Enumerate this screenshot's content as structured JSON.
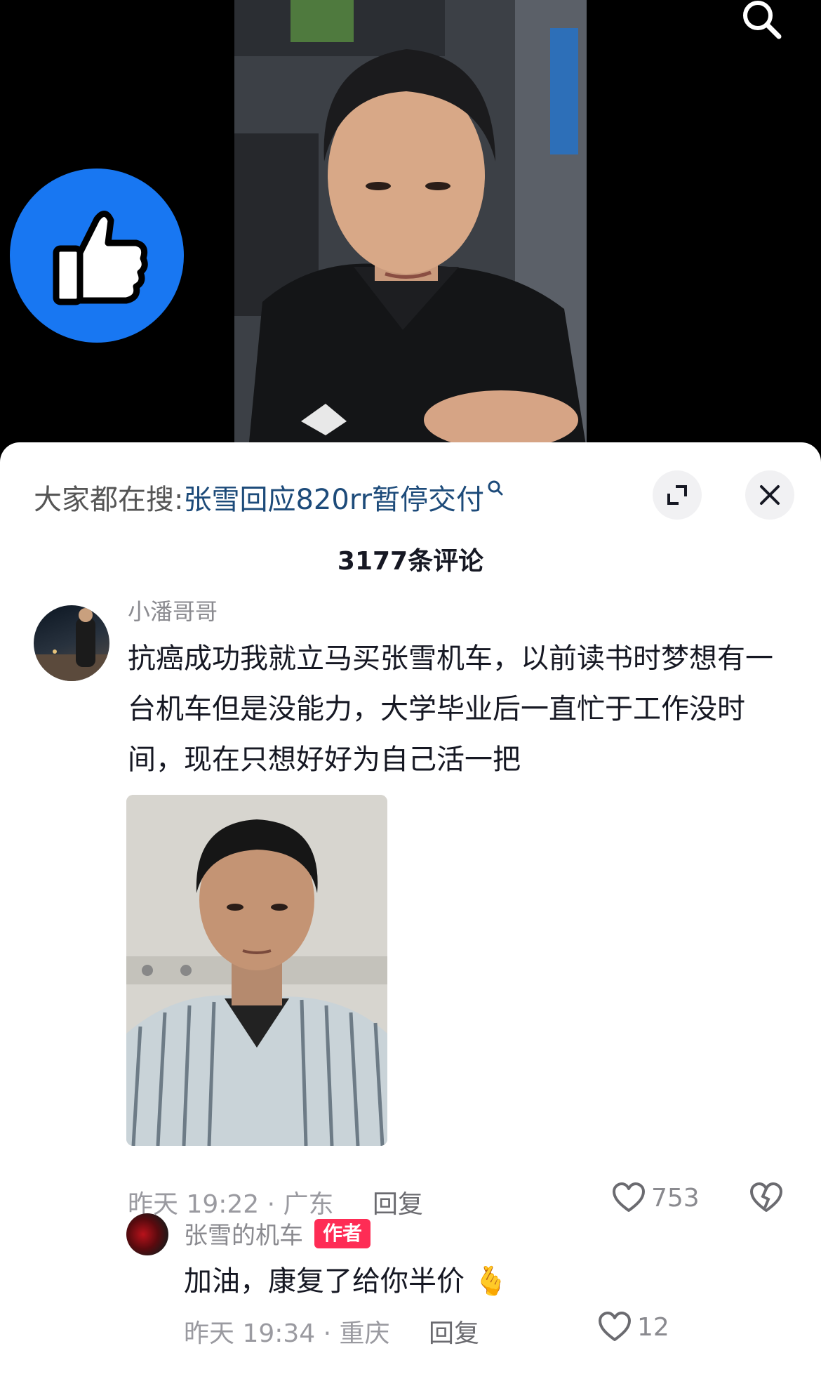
{
  "video": {
    "search_icon": "search-icon",
    "badge_icon": "thumbs-up-icon",
    "badge_color": "#1877f2"
  },
  "panel": {
    "trending_prefix": "大家都在搜:",
    "trending_query": "张雪回应820rr暂停交付",
    "expand_icon": "expand-icon",
    "close_icon": "close-icon",
    "comment_count": "3177条评论"
  },
  "comment": {
    "username": "小潘哥哥",
    "text": "抗癌成功我就立马买张雪机车，以前读书时梦想有一台机车但是没能力，大学毕业后一直忙于工作没时间，现在只想好好为自己活一把",
    "time_location": "昨天 19:22 · 广东",
    "reply_label": "回复",
    "likes": "753"
  },
  "reply": {
    "username": "张雪的机车",
    "author_tag": "作者",
    "text": "加油，康复了给你半价",
    "emoji": "🫰",
    "time_location": "昨天 19:34 · 重庆",
    "reply_label": "回复",
    "likes": "12"
  },
  "colors": {
    "accent": "#fe2c55",
    "link": "#1d4b7a"
  }
}
